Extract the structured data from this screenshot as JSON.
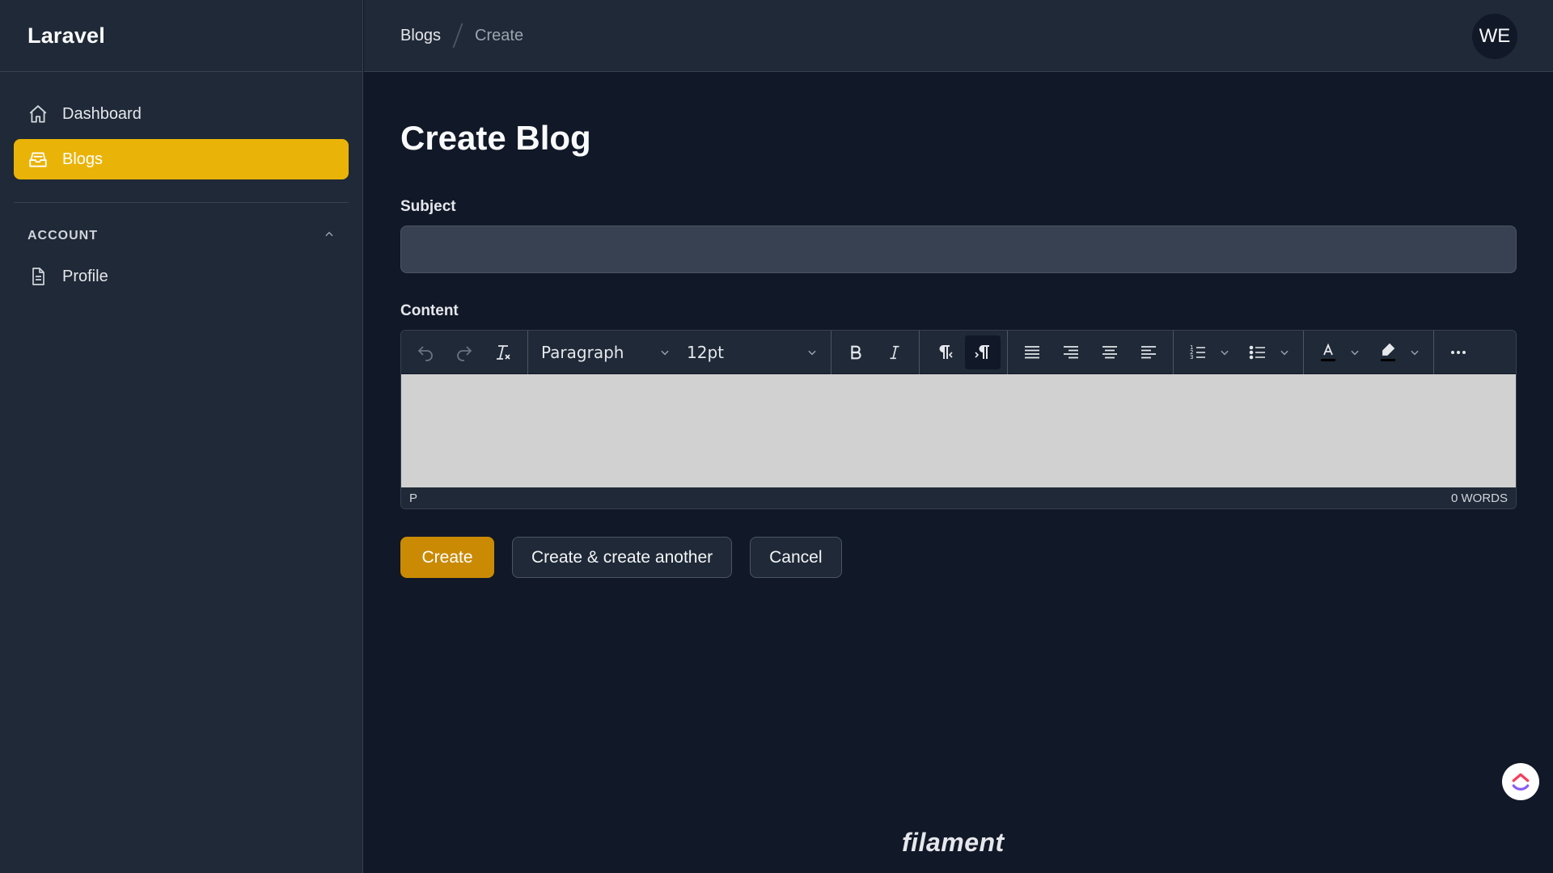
{
  "app": {
    "brand": "Laravel"
  },
  "sidebar": {
    "items": [
      {
        "label": "Dashboard",
        "icon": "home-icon",
        "active": false
      },
      {
        "label": "Blogs",
        "icon": "inbox-icon",
        "active": true
      }
    ],
    "groups": [
      {
        "title": "ACCOUNT",
        "collapse_icon": "chevron-up-icon",
        "items": [
          {
            "label": "Profile",
            "icon": "document-icon"
          }
        ]
      }
    ]
  },
  "header": {
    "breadcrumbs": [
      "Blogs",
      "Create"
    ],
    "avatar_initials": "WE"
  },
  "page": {
    "title": "Create Blog",
    "subject": {
      "label": "Subject",
      "value": "",
      "placeholder": ""
    },
    "content": {
      "label": "Content",
      "toolbar": {
        "block_format": "Paragraph",
        "font_size": "12pt",
        "buttons": [
          "undo-icon",
          "redo-icon",
          "clear-formatting-icon",
          "bold-icon",
          "italic-icon",
          "rtl-icon",
          "ltr-icon",
          "align-justify-icon",
          "align-right-icon",
          "align-center-icon",
          "align-left-icon",
          "numbered-list-icon",
          "bullet-list-icon",
          "text-color-icon",
          "highlight-color-icon",
          "more-icon"
        ]
      },
      "status_path": "P",
      "word_count": "0 WORDS"
    },
    "actions": {
      "create": "Create",
      "create_another": "Create & create another",
      "cancel": "Cancel"
    }
  },
  "footer": {
    "logo": "filament"
  },
  "colors": {
    "accent": "#eab308",
    "primary_button": "#ca8a04",
    "background": "#111827",
    "panel": "#1f2937"
  }
}
